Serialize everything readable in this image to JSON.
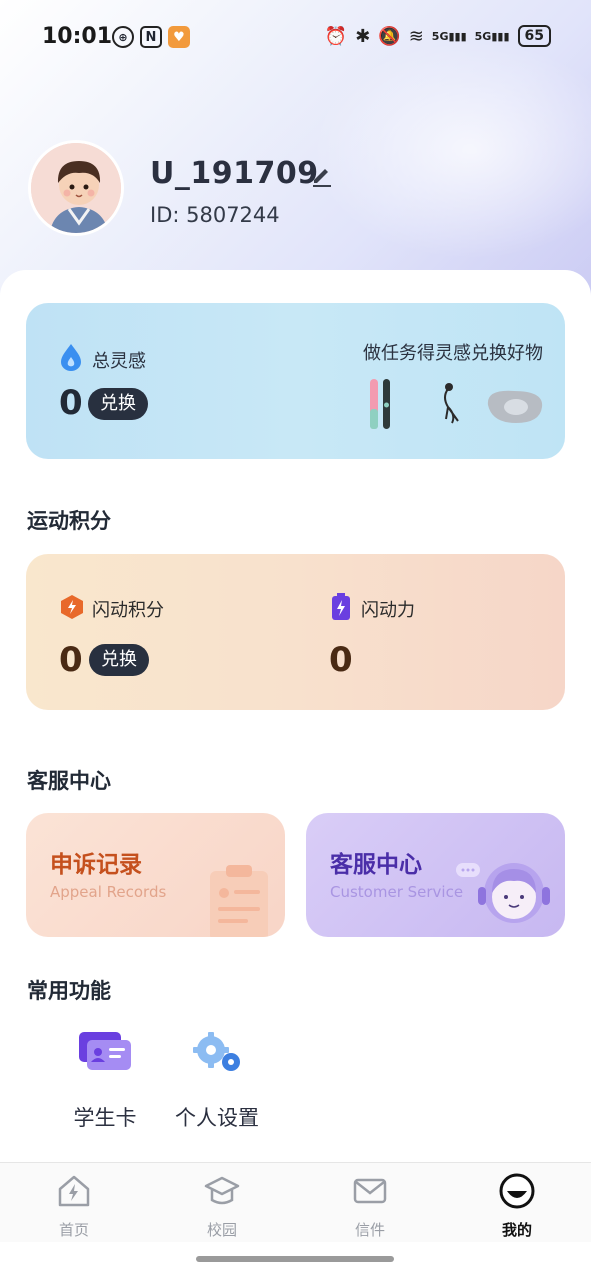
{
  "status_bar": {
    "time": "10:01",
    "battery": "65",
    "net_label_1": "5G",
    "net_label_2": "5G"
  },
  "profile": {
    "username": "U_191709",
    "user_id": "ID: 5807244"
  },
  "inspiration_card": {
    "title": "总灵感",
    "value": "0",
    "exchange_label": "兑换",
    "subtitle": "做任务得灵感兑换好物"
  },
  "sport_section": {
    "title": "运动积分",
    "points_label": "闪动积分",
    "points_value": "0",
    "exchange_label": "兑换",
    "power_label": "闪动力",
    "power_value": "0"
  },
  "service_section": {
    "title": "客服中心",
    "appeal_title": "申诉记录",
    "appeal_en": "Appeal Records",
    "service_title": "客服中心",
    "service_en": "Customer Service"
  },
  "common_section": {
    "title": "常用功能",
    "items": [
      {
        "label": "学生卡",
        "icon": "student-card-icon"
      },
      {
        "label": "个人设置",
        "icon": "settings-gear-icon"
      }
    ]
  },
  "tabbar": {
    "tabs": [
      {
        "label": "首页",
        "icon": "home-lightning-icon"
      },
      {
        "label": "校园",
        "icon": "graduation-cap-icon"
      },
      {
        "label": "信件",
        "icon": "mail-icon"
      },
      {
        "label": "我的",
        "icon": "profile-face-icon",
        "active": true
      }
    ]
  },
  "colors": {
    "inspiration_drop": "#3a8ff0",
    "sport_hex": "#e8692a",
    "battery_purple": "#6a3fe0",
    "appeal_text": "#c5501d",
    "service_text": "#4a2ea8"
  }
}
